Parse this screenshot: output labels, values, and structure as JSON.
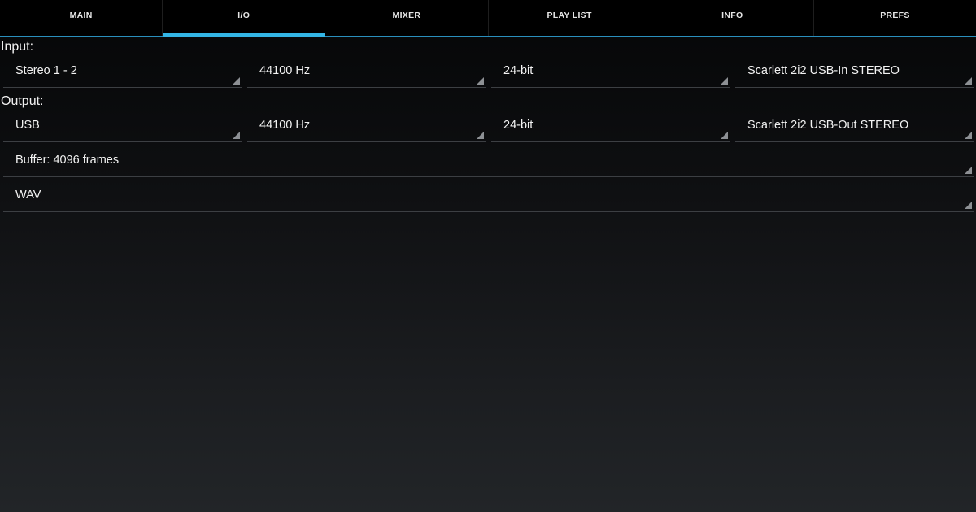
{
  "tabs": [
    {
      "label": "MAIN",
      "selected": false
    },
    {
      "label": "I/O",
      "selected": true
    },
    {
      "label": "MIXER",
      "selected": false
    },
    {
      "label": "PLAY LIST",
      "selected": false
    },
    {
      "label": "INFO",
      "selected": false
    },
    {
      "label": "PREFS",
      "selected": false
    }
  ],
  "accent_color": "#33b5e5",
  "input": {
    "label": "Input:",
    "channels": "Stereo 1 - 2",
    "sample_rate": "44100 Hz",
    "bit_depth": "24-bit",
    "device": "Scarlett 2i2 USB-In STEREO"
  },
  "output": {
    "label": "Output:",
    "channels": "USB",
    "sample_rate": "44100 Hz",
    "bit_depth": "24-bit",
    "device": "Scarlett 2i2 USB-Out STEREO"
  },
  "buffer": "Buffer: 4096 frames",
  "format": "WAV"
}
